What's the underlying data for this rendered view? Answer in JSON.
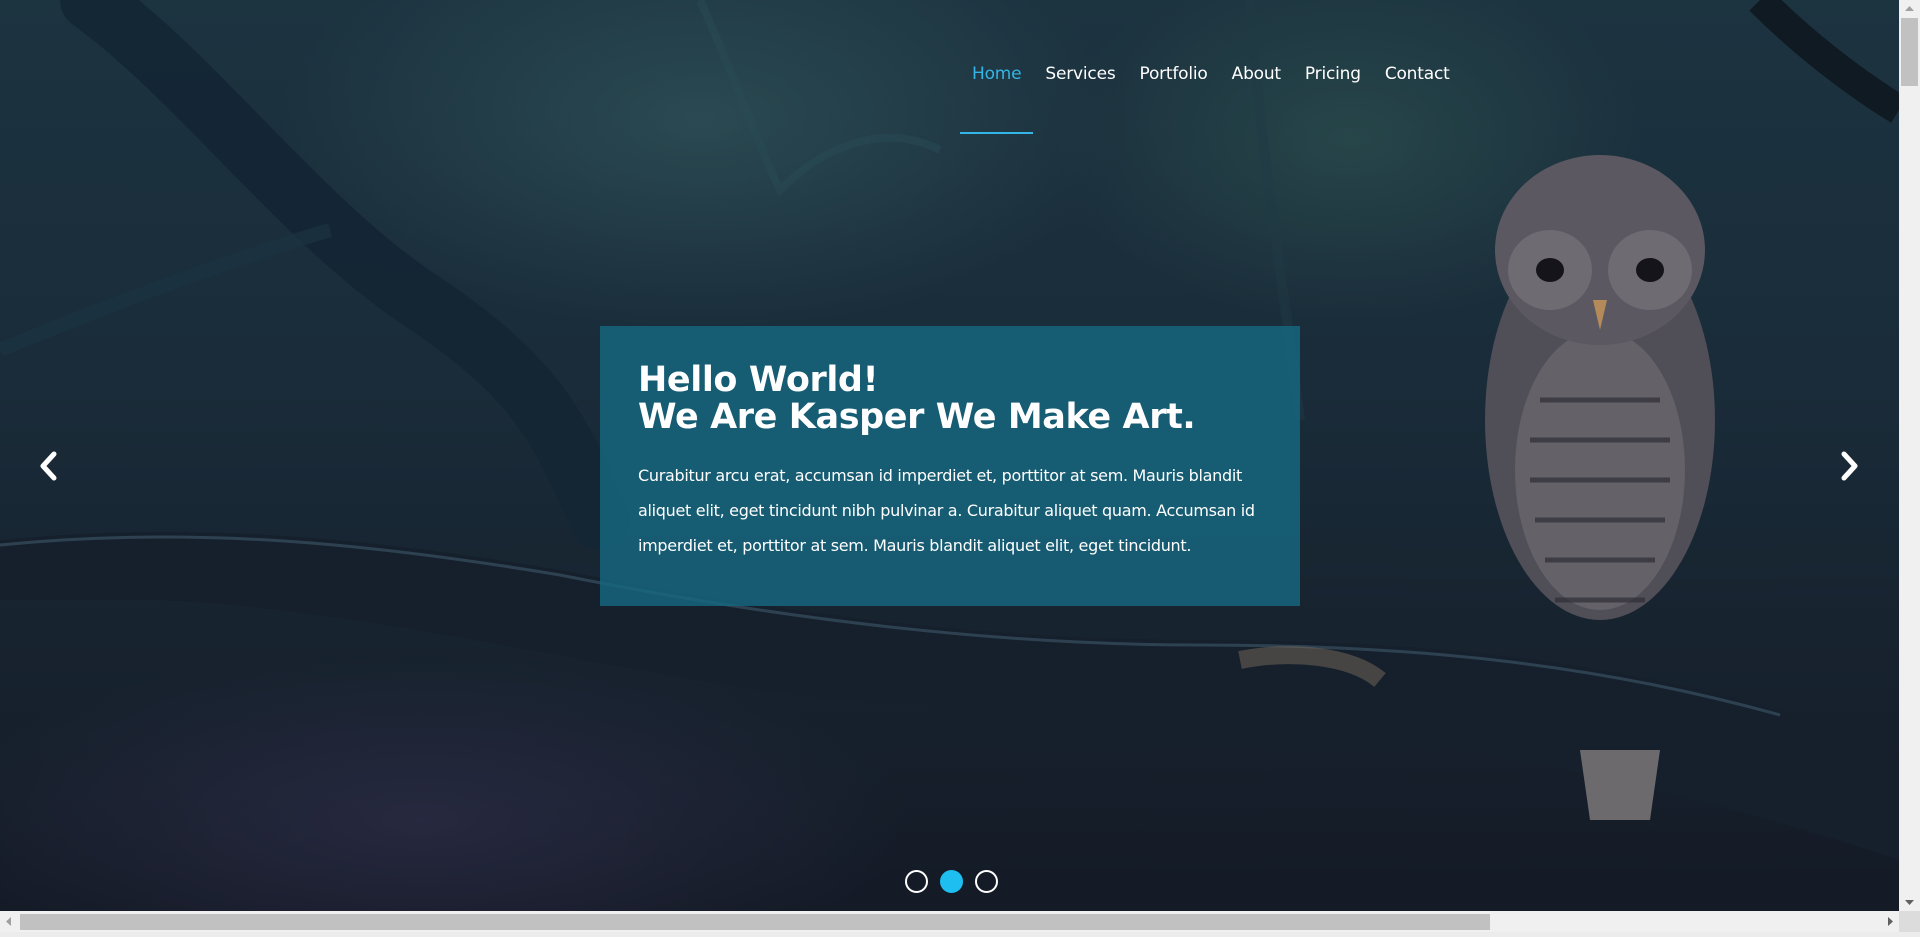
{
  "nav": {
    "items": [
      {
        "label": "Home",
        "active": true
      },
      {
        "label": "Services",
        "active": false
      },
      {
        "label": "Portfolio",
        "active": false
      },
      {
        "label": "About",
        "active": false
      },
      {
        "label": "Pricing",
        "active": false
      },
      {
        "label": "Contact",
        "active": false
      }
    ]
  },
  "hero": {
    "title_line1": "Hello World!",
    "title_line2": "We Are Kasper We Make Art.",
    "text": "Curabitur arcu erat, accumsan id imperdiet et, porttitor at sem. Mauris blandit aliquet elit, eget tincidunt nibh pulvinar a. Curabitur aliquet quam. Accumsan id imperdiet et, porttitor at sem. Mauris blandit aliquet elit, eget tincidunt.",
    "prev_icon": "chevron-left-icon",
    "next_icon": "chevron-right-icon"
  },
  "slider": {
    "slide_count": 3,
    "active_slide": 2
  },
  "colors": {
    "accent": "#35b5e6",
    "caption_bg": "#166880",
    "dot_active": "#1fbef0"
  }
}
